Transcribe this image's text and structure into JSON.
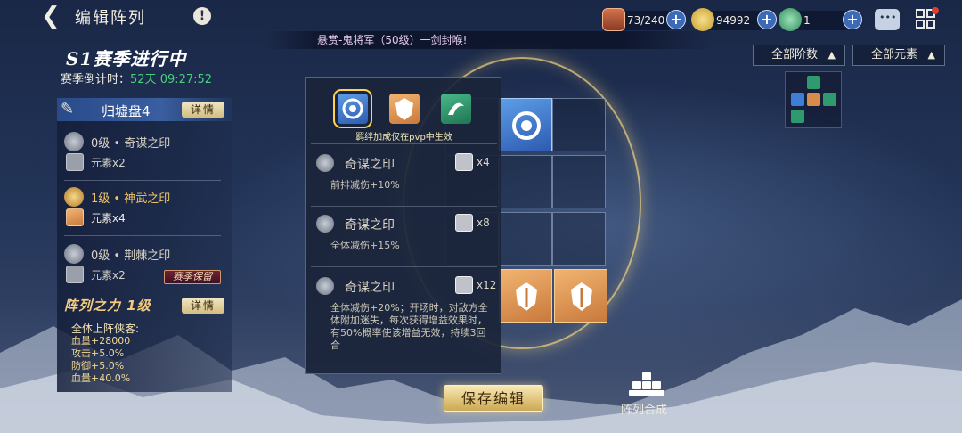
{
  "header": {
    "title": "编辑阵列",
    "info_label": "!",
    "resources": [
      {
        "name": "chest",
        "value": "73/240"
      },
      {
        "name": "gold-token",
        "value": "94992"
      },
      {
        "name": "jade-token",
        "value": "1"
      }
    ]
  },
  "marquee": {
    "text": "悬赏-鬼将军（50级）一剑封喉!"
  },
  "season": {
    "title": "S1赛季进行中",
    "countdown_label": "赛季倒计时：",
    "countdown_value": "52天 09:27:52"
  },
  "disc": {
    "name": "归墟盘4",
    "detail_label": "详情",
    "seals": [
      {
        "name": "0级 • 奇谋之印",
        "element": "元素x2",
        "icon": "spiral-seal-icon"
      },
      {
        "name": "1级 • 神武之印",
        "element": "元素x4",
        "icon": "shield-seal-icon"
      },
      {
        "name": "0级 • 荆棘之印",
        "element": "元素x2",
        "icon": "thorn-seal-icon"
      }
    ],
    "season_keep_label": "赛季保留"
  },
  "formation_power": {
    "title": "阵列之力 1级",
    "detail_label": "详情",
    "bonus_title": "全体上阵侠客:",
    "bonuses": [
      "血量+28000",
      "攻击+5.0%",
      "防御+5.0%",
      "血量+40.0%"
    ]
  },
  "seal_panel": {
    "pvp_note": "羁绊加成仅在pvp中生效",
    "tiers": [
      {
        "name": "奇谋之印",
        "count": "x4",
        "desc": "前排减伤+10%"
      },
      {
        "name": "奇谋之印",
        "count": "x8",
        "desc": "全体减伤+15%"
      },
      {
        "name": "奇谋之印",
        "count": "x12",
        "desc": "全体减伤+20%；开场时，对敌方全体附加迷失，每次获得增益效果时，有50%概率使该增益无效，持续3回合"
      }
    ]
  },
  "filters": {
    "tier_label": "全部阶数",
    "element_label": "全部元素",
    "arrow": "▲"
  },
  "actions": {
    "save_label": "保存编辑",
    "synth_label": "阵列合成"
  },
  "colors": {
    "accent_gold": "#e0c277",
    "countdown_green": "#46d17a",
    "blue_seal": "#3d7fd6",
    "orange_seal": "#d98c4a",
    "green_seal": "#2f9a6e"
  }
}
